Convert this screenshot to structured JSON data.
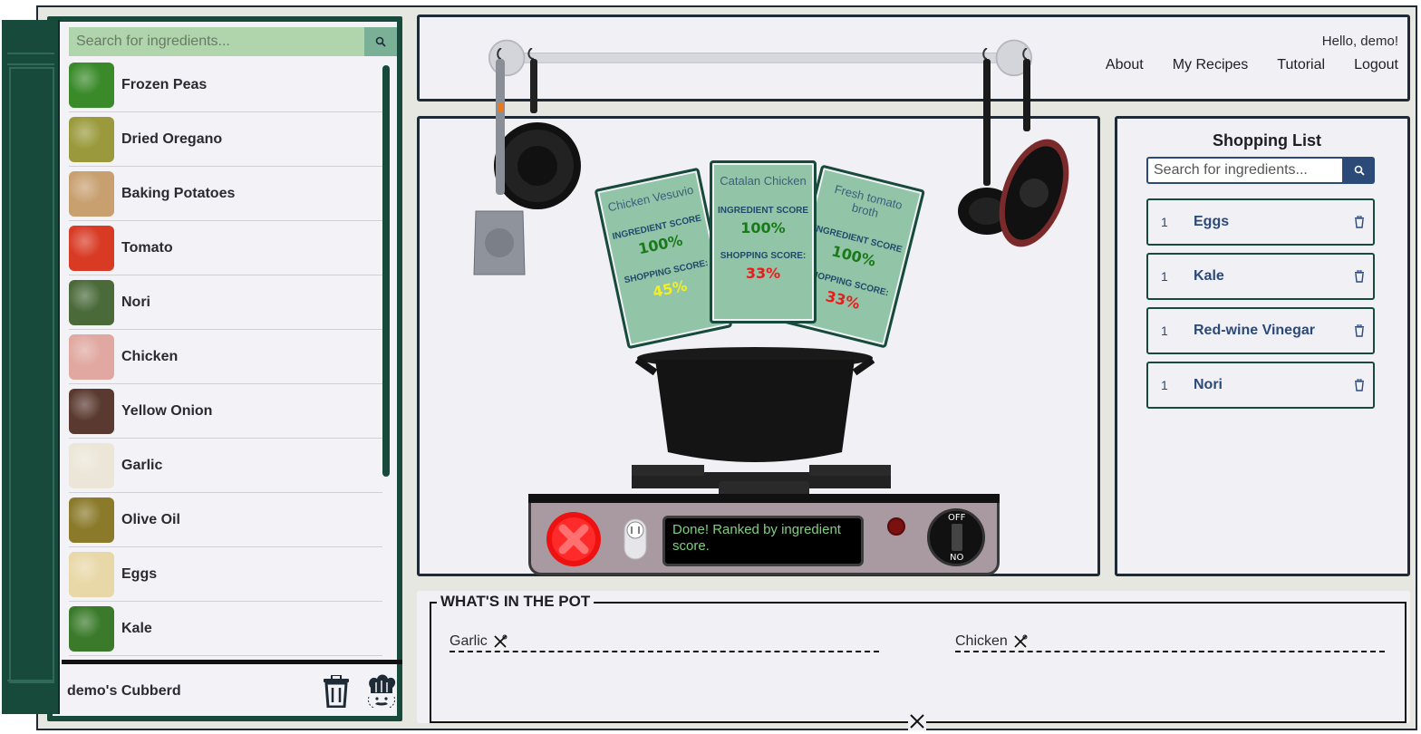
{
  "cupboard": {
    "search_placeholder": "Search for ingredients...",
    "items": [
      {
        "name": "Frozen Peas",
        "color": "#3a8a2a"
      },
      {
        "name": "Dried Oregano",
        "color": "#9a9a3c"
      },
      {
        "name": "Baking Potatoes",
        "color": "#c8a070"
      },
      {
        "name": "Tomato",
        "color": "#d83a24"
      },
      {
        "name": "Nori",
        "color": "#4a6a3a"
      },
      {
        "name": "Chicken",
        "color": "#e0a8a0"
      },
      {
        "name": "Yellow Onion",
        "color": "#5a3a30"
      },
      {
        "name": "Garlic",
        "color": "#ece6d8"
      },
      {
        "name": "Olive Oil",
        "color": "#8a7a2a"
      },
      {
        "name": "Eggs",
        "color": "#e8d8a8"
      },
      {
        "name": "Kale",
        "color": "#3a7a2a"
      }
    ],
    "footer_name": "demo's Cubberd"
  },
  "header": {
    "greeting": "Hello, demo!",
    "nav": [
      "About",
      "My Recipes",
      "Tutorial",
      "Logout"
    ]
  },
  "recipes": [
    {
      "title": "Chicken Vesuvio",
      "ingredient_label": "INGREDIENT SCORE:",
      "ingredient_score": "100%",
      "shopping_label": "SHOPPING SCORE:",
      "shopping_score": "45%",
      "shopping_color": "#f2ef2a"
    },
    {
      "title": "Catalan Chicken",
      "ingredient_label": "INGREDIENT SCORE:",
      "ingredient_score": "100%",
      "shopping_label": "SHOPPING SCORE:",
      "shopping_score": "33%",
      "shopping_color": "#ee1a1a"
    },
    {
      "title": "Fresh tomato broth",
      "ingredient_label": "INGREDIENT SCORE:",
      "ingredient_score": "100%",
      "shopping_label": "SHOPPING SCORE:",
      "shopping_score": "33%",
      "shopping_color": "#ee1a1a"
    }
  ],
  "stove": {
    "display_text": "Done! Ranked by ingredient score.",
    "knob_off": "OFF",
    "knob_on": "NO"
  },
  "shopping": {
    "title": "Shopping List",
    "search_placeholder": "Search for ingredients...",
    "items": [
      {
        "qty": "1",
        "name": "Eggs"
      },
      {
        "qty": "1",
        "name": "Kale"
      },
      {
        "qty": "1",
        "name": "Red-wine Vinegar"
      },
      {
        "qty": "1",
        "name": "Nori"
      }
    ]
  },
  "pot": {
    "title": "WHAT'S IN THE POT",
    "items": [
      "Garlic",
      "Chicken"
    ]
  }
}
